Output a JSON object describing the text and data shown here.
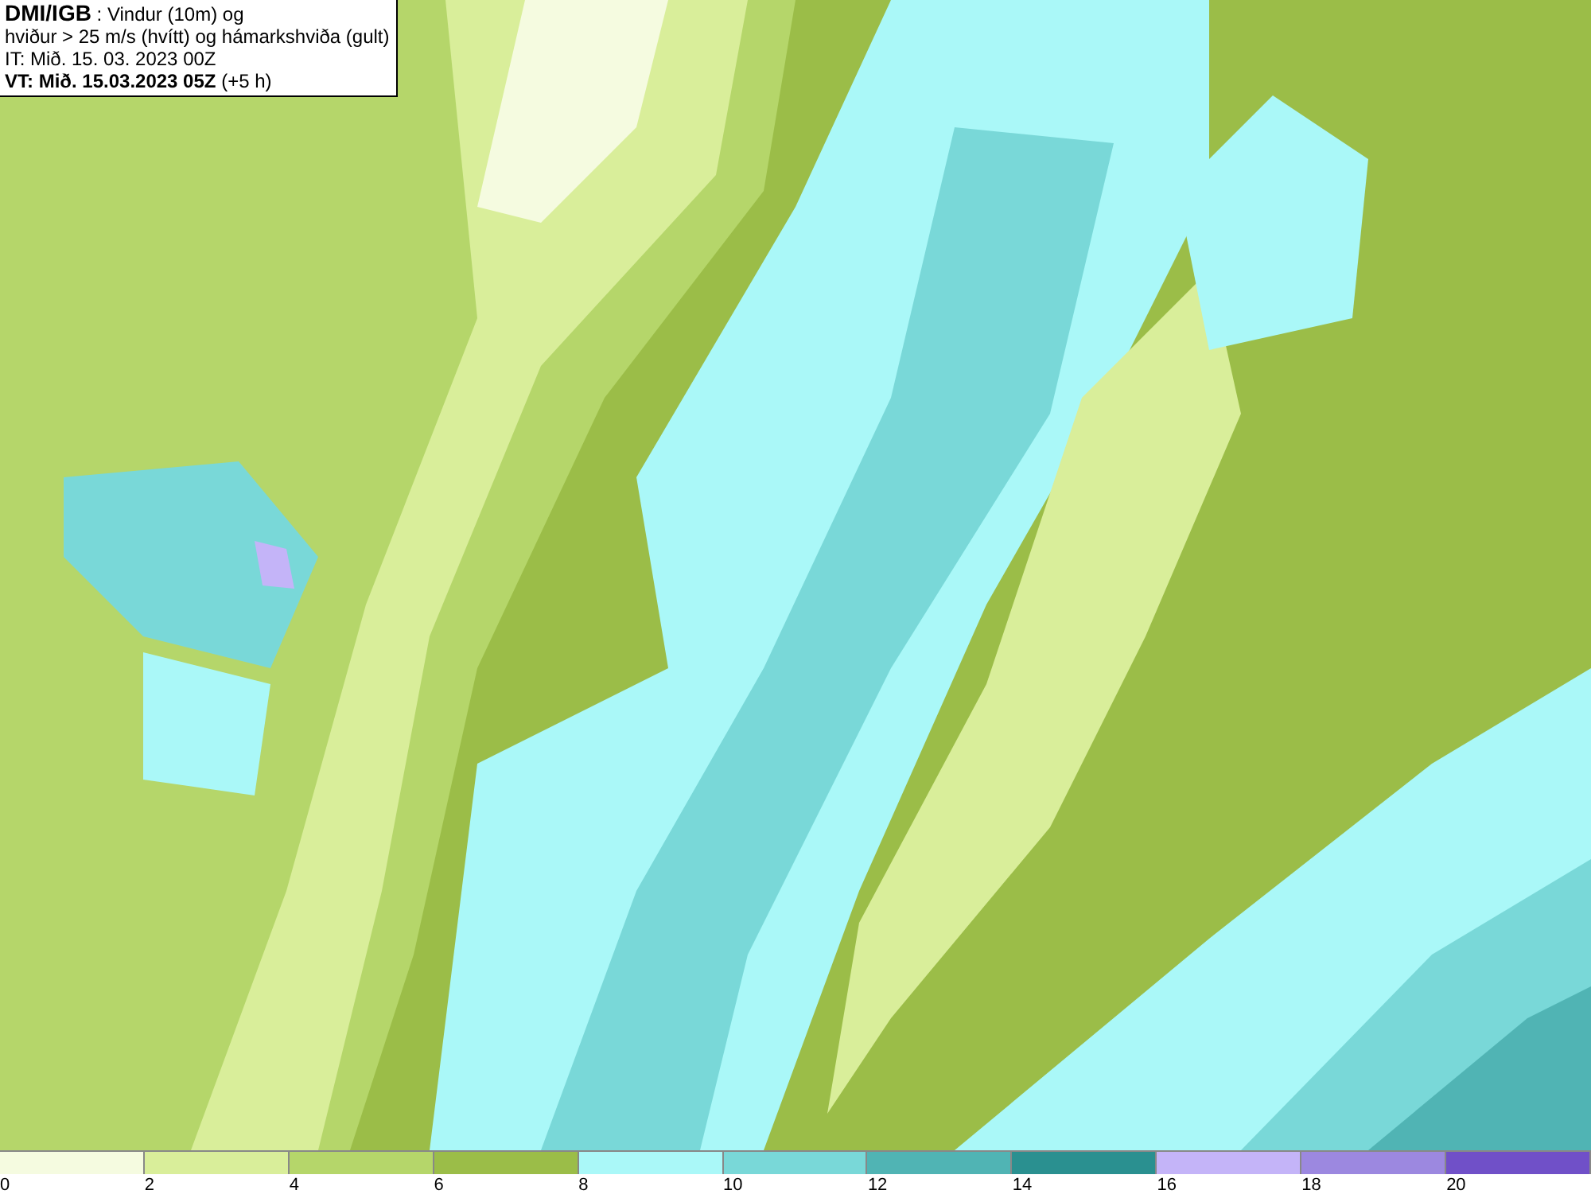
{
  "header": {
    "source": "DMI/IGB",
    "title_rest": " : Vindur (10m) og",
    "subtitle": "hviður > 25 m/s (hvítt) og hámarkshviða (gult)",
    "initial_time": "IT: Mið. 15. 03. 2023 00Z",
    "valid_time": "VT: Mið. 15.03.2023 05Z",
    "valid_offset": " (+5 h)"
  },
  "legend": [
    {
      "label": "0",
      "color": "#f5fbe0"
    },
    {
      "label": "2",
      "color": "#d9ee9a"
    },
    {
      "label": "4",
      "color": "#b5d66a"
    },
    {
      "label": "6",
      "color": "#9bbd48"
    },
    {
      "label": "8",
      "color": "#aaf8f8"
    },
    {
      "label": "10",
      "color": "#79d8d8"
    },
    {
      "label": "12",
      "color": "#50b4b4"
    },
    {
      "label": "14",
      "color": "#2a9090"
    },
    {
      "label": "16",
      "color": "#c4b4f8"
    },
    {
      "label": "18",
      "color": "#9c88e0"
    },
    {
      "label": "20",
      "color": "#7050c8"
    }
  ]
}
